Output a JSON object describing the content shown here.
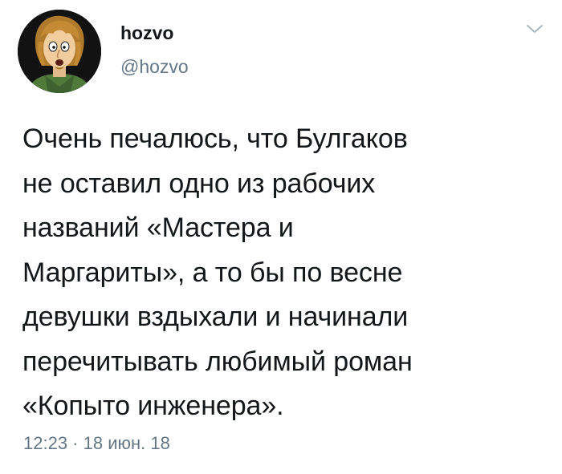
{
  "author": {
    "display_name": "hozvo",
    "handle": "@hozvo",
    "avatar_icon": "cartoon-character-avatar"
  },
  "menu_icon": "chevron-down-icon",
  "tweet": {
    "lines": [
      "Очень печалюсь, что Булгаков",
      "не оставил одно из рабочих",
      "названий «Мастера и",
      "Маргариты», а то бы по весне",
      "девушки вздыхали и начинали",
      "перечитывать любимый роман",
      "«Копыто инженера»."
    ]
  },
  "meta": {
    "timestamp": "12:23 · 18 июн. 18"
  },
  "colors": {
    "text_primary": "#14171a",
    "text_secondary": "#657786",
    "chevron": "#aab8c2",
    "background": "#ffffff"
  }
}
